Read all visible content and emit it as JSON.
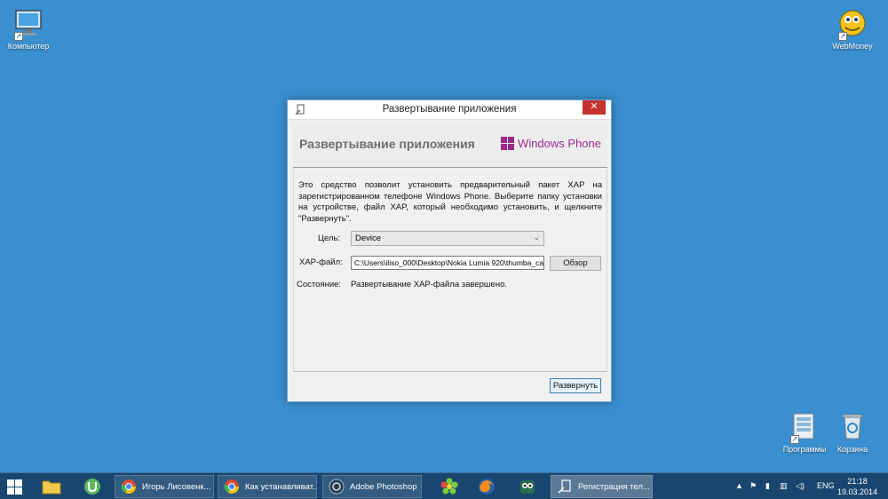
{
  "desktop": {
    "icons": [
      {
        "label": "Компьютер"
      },
      {
        "label": "WebMoney"
      },
      {
        "label": "Программы"
      },
      {
        "label": "Корзина"
      }
    ]
  },
  "dialog": {
    "title": "Развертывание приложения",
    "close_glyph": "✕",
    "header_title": "Развертывание приложения",
    "brand": "Windows Phone",
    "description": "Это средство позволит установить предварительный пакет XAP на зарегистрированном телефоне Windows Phone. Выберите папку установки на устройстве, файл XAP, который необходимо установить, и щелкните \"Развернуть\".",
    "target_label": "Цель:",
    "target_value": "Device",
    "xap_label": "XAP-файл:",
    "xap_value": "C:\\Users\\iliso_000\\Desktop\\Nokia Lumia 920\\thumba_ca",
    "browse_label": "Обзор",
    "status_label": "Состояние:",
    "status_value": "Развертывание XAP-файла завершено.",
    "deploy_label": "Развернуть"
  },
  "taskbar": {
    "tasks": [
      {
        "label": "Игорь Лисовенк..."
      },
      {
        "label": "Как устанавливат..."
      },
      {
        "label": "Adobe Photoshop"
      },
      {
        "label": "Регистрация тел..."
      }
    ],
    "tray": {
      "language": "ENG",
      "time": "21:18",
      "date": "19.03.2014"
    }
  },
  "colors": {
    "desktop": "#3a8fd0",
    "taskbar": "#19466f",
    "close_button": "#c7322f",
    "brand_purple": "#9b2a8b"
  }
}
